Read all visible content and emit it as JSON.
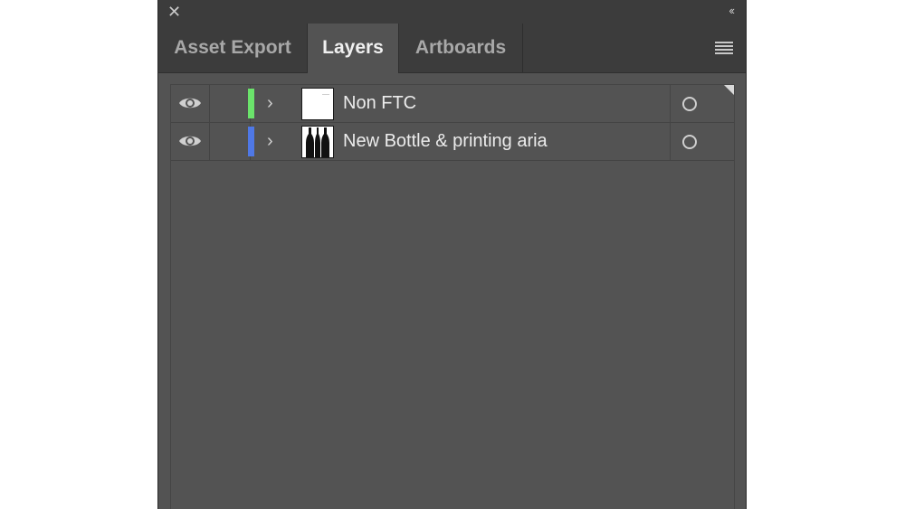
{
  "window": {
    "close_icon": "close-icon",
    "collapse_label": "‹‹"
  },
  "tabs": [
    {
      "label": "Asset Export",
      "active": false
    },
    {
      "label": "Layers",
      "active": true
    },
    {
      "label": "Artboards",
      "active": false
    }
  ],
  "panel_menu_icon": "hamburger-menu-icon",
  "layers": [
    {
      "name": "Non FTC",
      "color": "#6be36b",
      "visible": true,
      "thumbnail": "blank-artboard"
    },
    {
      "name": "New Bottle & printing aria",
      "color": "#4f78e6",
      "visible": true,
      "thumbnail": "bottles-artboard"
    }
  ]
}
